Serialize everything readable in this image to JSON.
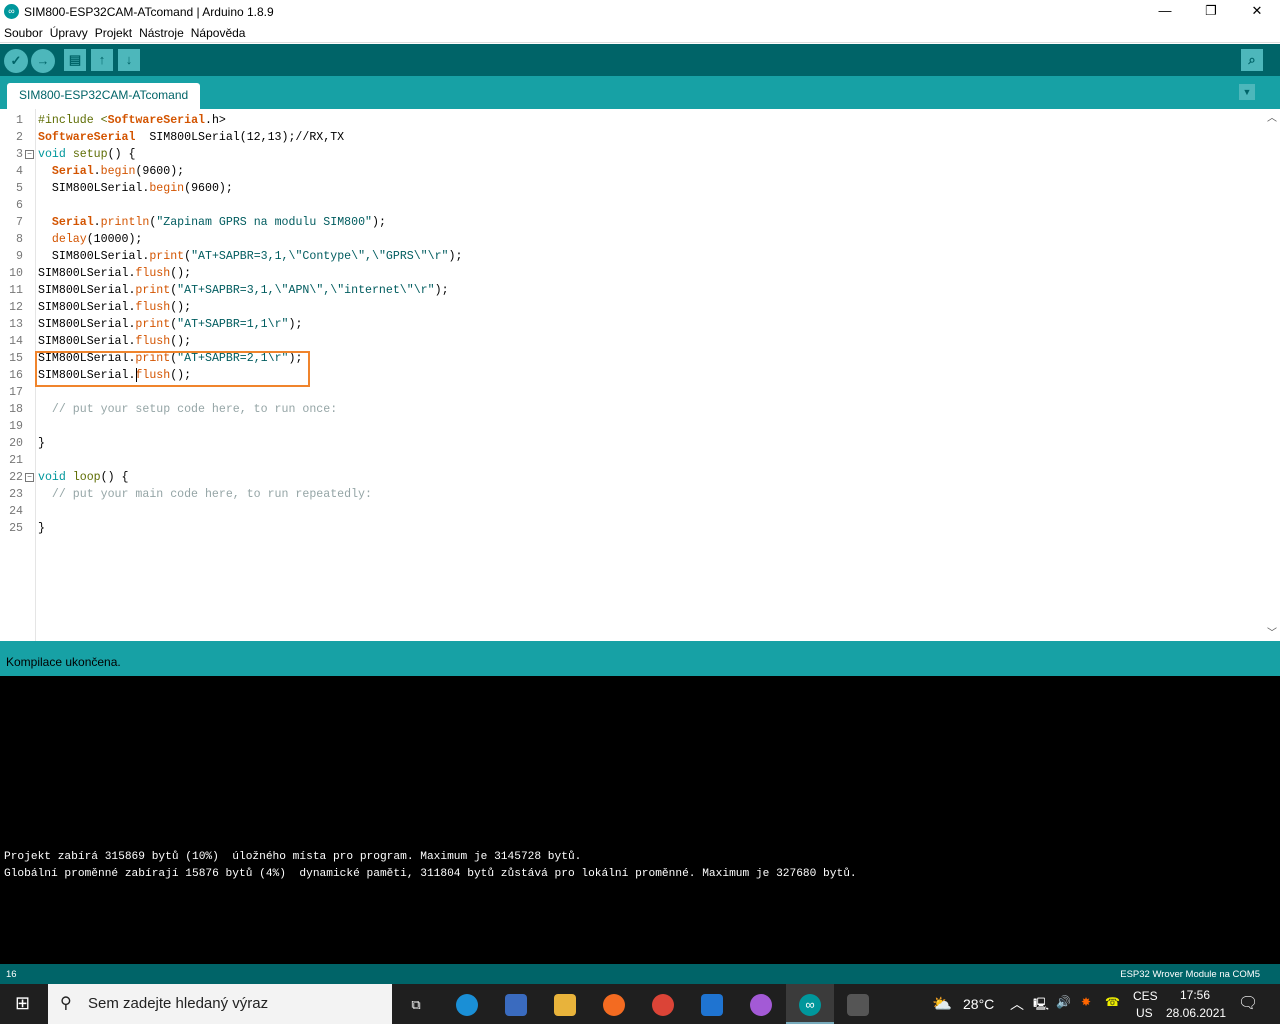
{
  "window": {
    "title": "SIM800-ESP32CAM-ATcomand | Arduino 1.8.9",
    "minimize": "—",
    "restore": "❐",
    "close": "✕"
  },
  "menu": [
    "Soubor",
    "Úpravy",
    "Projekt",
    "Nástroje",
    "Nápověda"
  ],
  "toolbar": {
    "verify": "✓",
    "upload": "→",
    "new": "▤",
    "open": "↑",
    "save": "↓",
    "serial_monitor": "⌕"
  },
  "tab": {
    "label": "SIM800-ESP32CAM-ATcomand",
    "menu": "▼"
  },
  "code_lines": [
    [
      {
        "t": "#include <",
        "c": "pp"
      },
      {
        "t": "SoftwareSerial",
        "c": "kw"
      },
      {
        "t": ".h>",
        "c": "pl"
      }
    ],
    [
      {
        "t": "SoftwareSerial",
        "c": "kw"
      },
      {
        "t": "  SIM800LSerial(12,13);//RX,TX",
        "c": "pl"
      }
    ],
    [
      {
        "t": "void",
        "c": "ty"
      },
      {
        "t": " ",
        "c": "pl"
      },
      {
        "t": "setup",
        "c": "sv"
      },
      {
        "t": "() {",
        "c": "pl"
      }
    ],
    [
      {
        "t": "  ",
        "c": "pl"
      },
      {
        "t": "Serial",
        "c": "kw"
      },
      {
        "t": ".",
        "c": "pl"
      },
      {
        "t": "begin",
        "c": "fn"
      },
      {
        "t": "(9600);",
        "c": "pl"
      }
    ],
    [
      {
        "t": "  SIM800LSerial.",
        "c": "pl"
      },
      {
        "t": "begin",
        "c": "fn"
      },
      {
        "t": "(9600);",
        "c": "pl"
      }
    ],
    [],
    [
      {
        "t": "  ",
        "c": "pl"
      },
      {
        "t": "Serial",
        "c": "kw"
      },
      {
        "t": ".",
        "c": "pl"
      },
      {
        "t": "println",
        "c": "fn"
      },
      {
        "t": "(",
        "c": "pl"
      },
      {
        "t": "\"Zapinam GPRS na modulu SIM800\"",
        "c": "st"
      },
      {
        "t": ");",
        "c": "pl"
      }
    ],
    [
      {
        "t": "  ",
        "c": "pl"
      },
      {
        "t": "delay",
        "c": "fn"
      },
      {
        "t": "(10000);",
        "c": "pl"
      }
    ],
    [
      {
        "t": "  SIM800LSerial.",
        "c": "pl"
      },
      {
        "t": "print",
        "c": "fn"
      },
      {
        "t": "(",
        "c": "pl"
      },
      {
        "t": "\"AT+SAPBR=3,1,\\\"Contype\\\",\\\"GPRS\\\"\\r\"",
        "c": "st"
      },
      {
        "t": ");",
        "c": "pl"
      }
    ],
    [
      {
        "t": "SIM800LSerial.",
        "c": "pl"
      },
      {
        "t": "flush",
        "c": "fn"
      },
      {
        "t": "();",
        "c": "pl"
      }
    ],
    [
      {
        "t": "SIM800LSerial.",
        "c": "pl"
      },
      {
        "t": "print",
        "c": "fn"
      },
      {
        "t": "(",
        "c": "pl"
      },
      {
        "t": "\"AT+SAPBR=3,1,\\\"APN\\\",\\\"internet\\\"\\r\"",
        "c": "st"
      },
      {
        "t": ");",
        "c": "pl"
      }
    ],
    [
      {
        "t": "SIM800LSerial.",
        "c": "pl"
      },
      {
        "t": "flush",
        "c": "fn"
      },
      {
        "t": "();",
        "c": "pl"
      }
    ],
    [
      {
        "t": "SIM800LSerial.",
        "c": "pl"
      },
      {
        "t": "print",
        "c": "fn"
      },
      {
        "t": "(",
        "c": "pl"
      },
      {
        "t": "\"AT+SAPBR=1,1\\r\"",
        "c": "st"
      },
      {
        "t": ");",
        "c": "pl"
      }
    ],
    [
      {
        "t": "SIM800LSerial.",
        "c": "pl"
      },
      {
        "t": "flush",
        "c": "fn"
      },
      {
        "t": "();",
        "c": "pl"
      }
    ],
    [
      {
        "t": "SIM800LSerial.",
        "c": "pl"
      },
      {
        "t": "print",
        "c": "fn"
      },
      {
        "t": "(",
        "c": "pl"
      },
      {
        "t": "\"AT+SAPBR=2,1\\r\"",
        "c": "st"
      },
      {
        "t": ");",
        "c": "pl"
      }
    ],
    [
      {
        "t": "SIM800LSerial.",
        "c": "pl"
      },
      {
        "t": "flush",
        "c": "fn"
      },
      {
        "t": "();",
        "c": "pl"
      }
    ],
    [],
    [
      {
        "t": "  // put your setup code here, to run once:",
        "c": "cm"
      }
    ],
    [],
    [
      {
        "t": "}",
        "c": "pl"
      }
    ],
    [],
    [
      {
        "t": "void",
        "c": "ty"
      },
      {
        "t": " ",
        "c": "pl"
      },
      {
        "t": "loop",
        "c": "sv"
      },
      {
        "t": "() {",
        "c": "pl"
      }
    ],
    [
      {
        "t": "  // put your main code here, to run repeatedly:",
        "c": "cm"
      }
    ],
    [],
    [
      {
        "t": "}",
        "c": "pl"
      }
    ]
  ],
  "status": {
    "message": "Kompilace ukončena."
  },
  "console": [
    "Projekt zabírá 315869 bytů (10%)  úložného místa pro program. Maximum je 3145728 bytů.",
    "Globální proměnné zabírají 15876 bytů (4%)  dynamické paměti, 311804 bytů zůstává pro lokální proměnné. Maximum je 327680 bytů."
  ],
  "bottombar": {
    "line": "16",
    "board": "ESP32 Wrover Module na COM5"
  },
  "taskbar": {
    "search_placeholder": "Sem zadejte hledaný výraz",
    "temperature": "28°C",
    "lang1": "CES",
    "lang2": "US",
    "time": "17:56",
    "date": "28.06.2021"
  }
}
